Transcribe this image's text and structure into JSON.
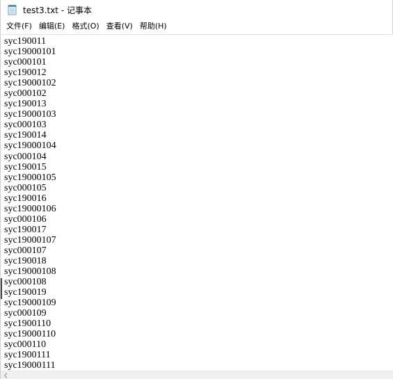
{
  "window": {
    "title": "test3.txt - 记事本",
    "icon": "notepad-icon"
  },
  "menu": {
    "items": [
      {
        "label": "文件(F)"
      },
      {
        "label": "编辑(E)"
      },
      {
        "label": "格式(O)"
      },
      {
        "label": "查看(V)"
      },
      {
        "label": "帮助(H)"
      }
    ]
  },
  "editor": {
    "lines": [
      "syc190011",
      "syc19000101",
      "syc000101",
      "syc190012",
      "syc19000102",
      "syc000102",
      "syc190013",
      "syc19000103",
      "syc000103",
      "syc190014",
      "syc19000104",
      "syc000104",
      "syc190015",
      "syc19000105",
      "syc000105",
      "syc190016",
      "syc19000106",
      "syc000106",
      "syc190017",
      "syc19000107",
      "syc000107",
      "syc190018",
      "syc19000108",
      "syc000108",
      "syc190019",
      "syc19000109",
      "syc000109",
      "syc1900110",
      "syc19000110",
      "syc000110",
      "syc1900111",
      "syc19000111"
    ]
  },
  "scrollbar": {
    "left_arrow_icon": "chevron-left-icon"
  }
}
